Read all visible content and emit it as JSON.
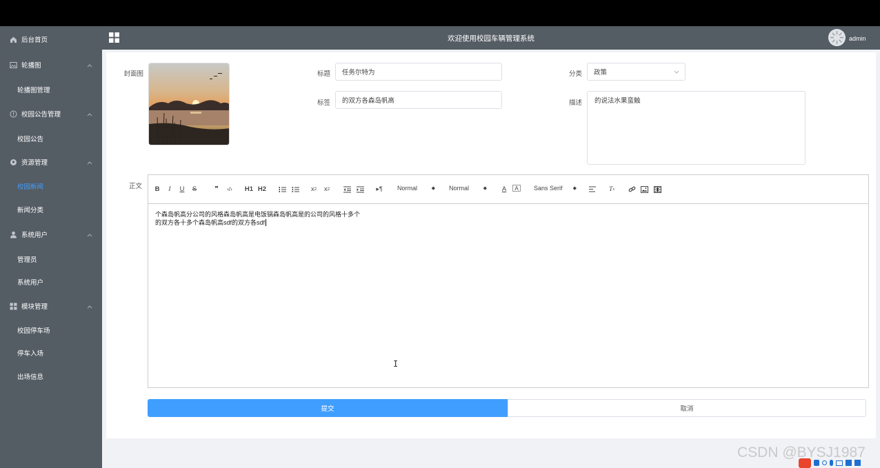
{
  "header": {
    "title": "欢迎使用校园车辆管理系统",
    "username": "admin"
  },
  "sidebar": {
    "home": "后台首页",
    "groups": [
      {
        "label": "轮播图",
        "items": [
          "轮播图管理"
        ]
      },
      {
        "label": "校园公告管理",
        "items": [
          "校园公告"
        ]
      },
      {
        "label": "资源管理",
        "items": [
          "校园新闻",
          "新闻分类"
        ]
      },
      {
        "label": "系统用户",
        "items": [
          "管理员",
          "系统用户"
        ]
      },
      {
        "label": "模块管理",
        "items": [
          "校园停车场",
          "停车入场",
          "出场信息"
        ]
      }
    ]
  },
  "form": {
    "cover_label": "封面图",
    "title_label": "标题",
    "title_value": "任务尔特为",
    "tag_label": "标签",
    "tag_value": "的双方各森岛帆高",
    "category_label": "分类",
    "category_value": "政策",
    "desc_label": "描述",
    "desc_value": "的说法水果蛮触",
    "body_label": "正文",
    "body_line1": "个森岛帆高分公司的风格森岛帆高是电饭锅森岛帆高是的公司的风格十多个",
    "body_line2": "的双方各十多个森岛帆高sdf的双方各sdf",
    "submit": "提交",
    "cancel": "取消"
  },
  "toolbar": {
    "size_picker": "Normal",
    "header_picker": "Normal",
    "font_picker": "Sans Serif",
    "h1": "H1",
    "h2": "H2"
  },
  "watermark": "CSDN @BYSJ1987",
  "colors": {
    "sidebar": "#545c64",
    "accent": "#409eff",
    "background": "#f0f2f5"
  }
}
